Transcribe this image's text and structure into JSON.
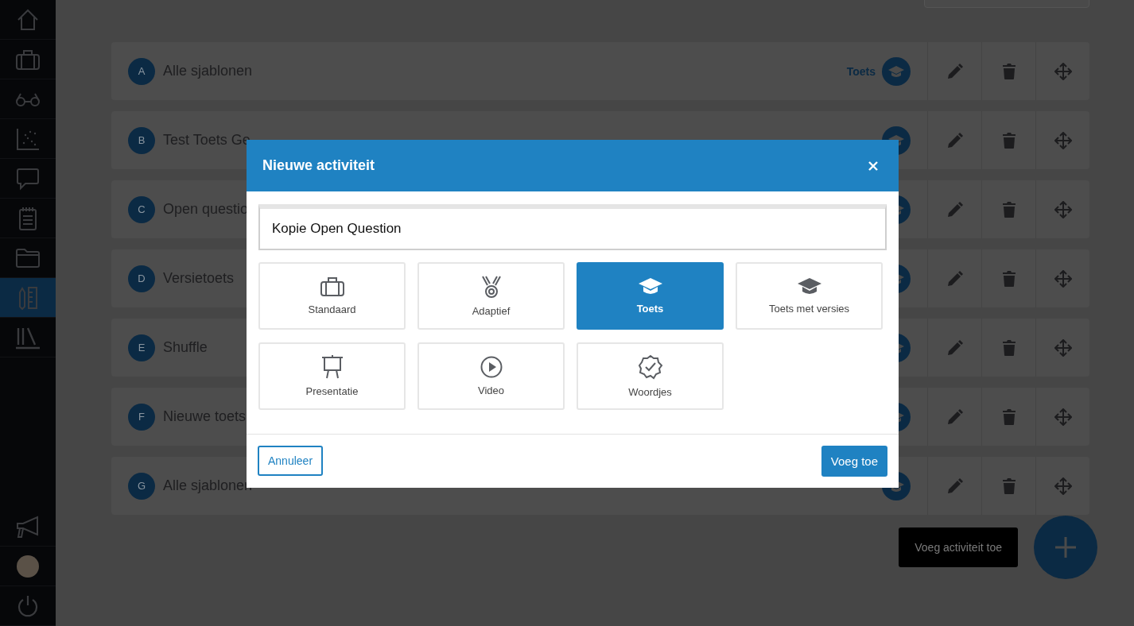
{
  "sidebar": {
    "items": [
      {
        "kind": "home",
        "selected": false
      },
      {
        "kind": "briefcase",
        "selected": false
      },
      {
        "kind": "glasses",
        "selected": false
      },
      {
        "kind": "scatter",
        "selected": false
      },
      {
        "kind": "chat",
        "selected": false
      },
      {
        "kind": "notepad",
        "selected": false
      },
      {
        "kind": "folder",
        "selected": false
      },
      {
        "kind": "ruler",
        "selected": true
      },
      {
        "kind": "library",
        "selected": false
      }
    ],
    "bottom_items": [
      {
        "kind": "megaphone"
      },
      {
        "kind": "avatar"
      },
      {
        "kind": "power"
      }
    ]
  },
  "activities": [
    {
      "letter": "A",
      "title": "Alle sjablonen",
      "type": "Toets"
    },
    {
      "letter": "B",
      "title": "Test Toets Ge"
    },
    {
      "letter": "C",
      "title": "Open questio"
    },
    {
      "letter": "D",
      "title": "Versietoets"
    },
    {
      "letter": "E",
      "title": "Shuffle"
    },
    {
      "letter": "F",
      "title": "Nieuwe toets"
    },
    {
      "letter": "G",
      "title": "Alle sjablonen"
    }
  ],
  "dialog": {
    "title": "Nieuwe activiteit",
    "name_field": {
      "value": "Kopie Open Question"
    },
    "options": [
      {
        "kind": "briefcase",
        "label": "Standaard",
        "selected": false
      },
      {
        "kind": "medal",
        "label": "Adaptief",
        "selected": false
      },
      {
        "kind": "cap",
        "label": "Toets",
        "selected": true
      },
      {
        "kind": "cap",
        "label": "Toets met versies",
        "selected": false
      },
      {
        "kind": "easel",
        "label": "Presentatie",
        "selected": false
      },
      {
        "kind": "play",
        "label": "Video",
        "selected": false
      },
      {
        "kind": "badge",
        "label": "Woordjes",
        "selected": false
      }
    ],
    "cancel_button": "Annuleer",
    "confirm_button": "Voeg toe"
  },
  "add_tooltip": "Voeg activiteit toe"
}
